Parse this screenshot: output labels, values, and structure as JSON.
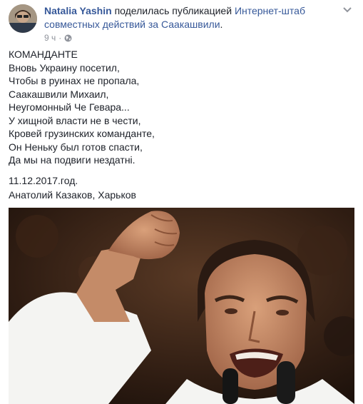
{
  "post": {
    "author": "Natalia Yashin",
    "action": " поделилась публикацией ",
    "shared_page": "Интернет-штаб совместных действий за Саакашвили",
    "suffix": ".",
    "time": "9 ч",
    "separator": "·",
    "privacy_icon": "globe-icon",
    "more_icon": "chevron-down-icon"
  },
  "poem": {
    "lines": [
      "КОМАНДАНТЕ",
      "Вновь Украину посетил,",
      "Чтобы в руинах не пропала,",
      "Саакашвили Михаил,",
      "Неугомонный Че Гевара...",
      "У хищной власти не в чести,",
      "Кровей грузинских команданте,",
      "Он Неньку был готов спасти,",
      "Да мы на подвиги нездатні."
    ],
    "date": "11.12.2017.год.",
    "signature": "Анатолий Казаков, Харьков"
  },
  "colors": {
    "link": "#365899",
    "meta": "#90949c",
    "text": "#1d2129"
  }
}
